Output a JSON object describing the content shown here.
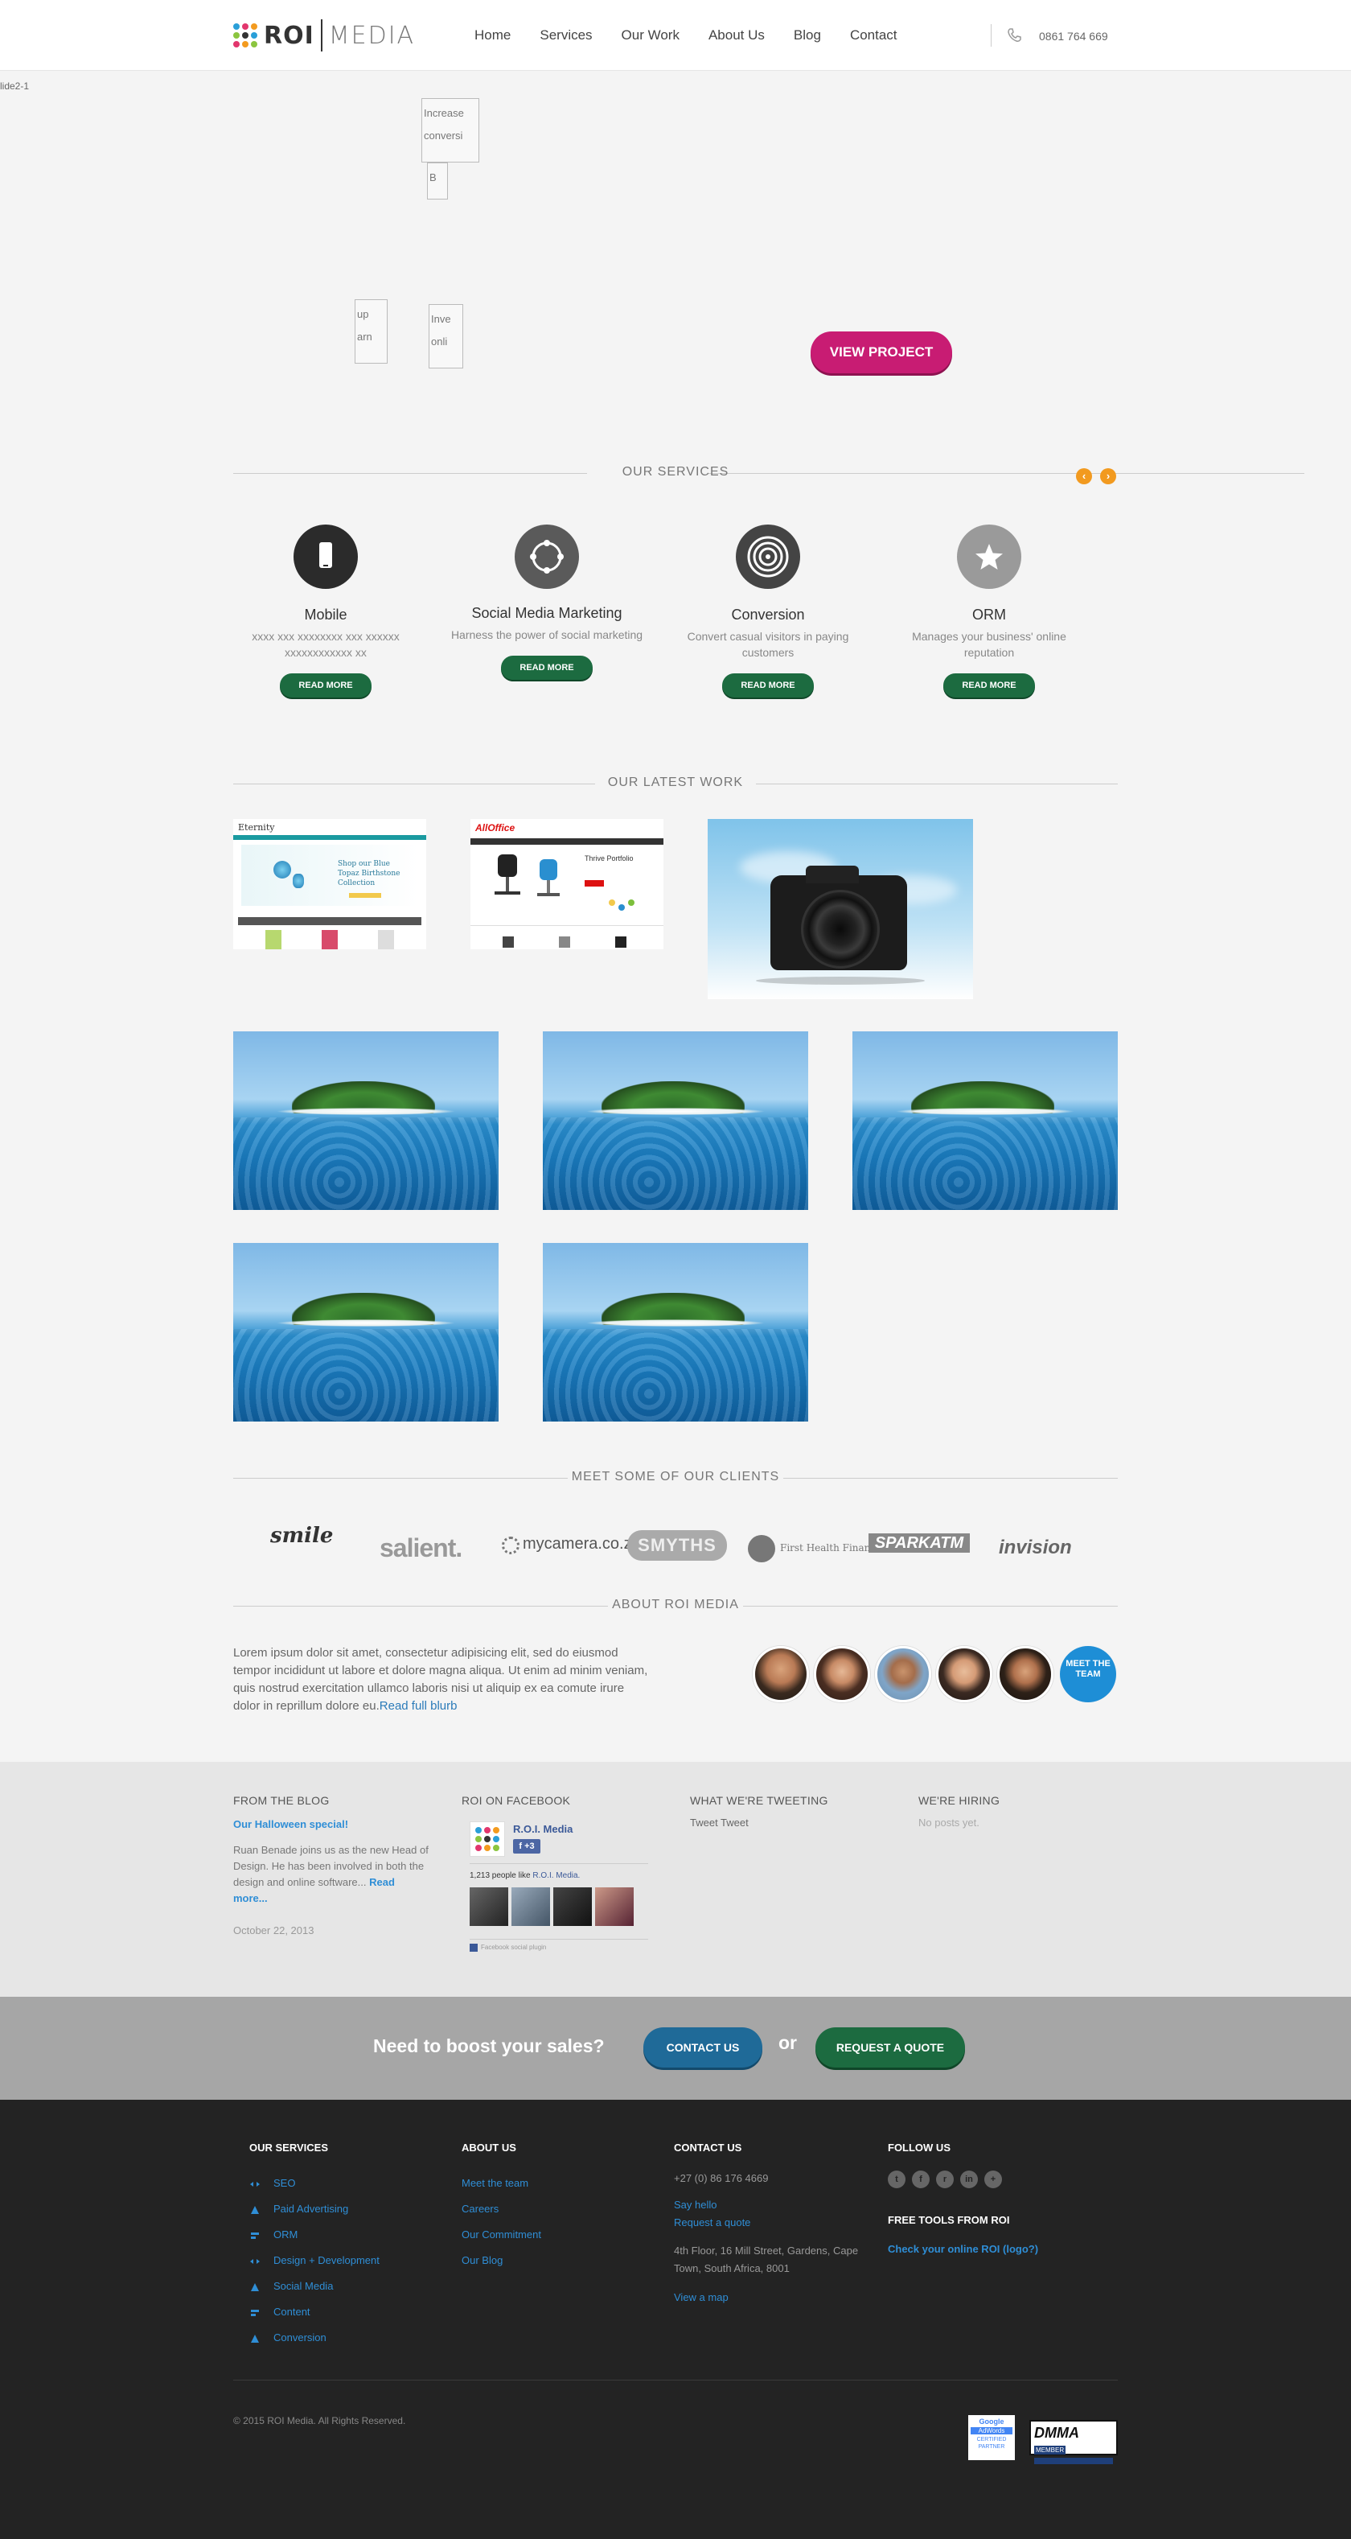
{
  "header": {
    "logo": {
      "roi": "ROI",
      "media": "MEDIA"
    },
    "nav": [
      "Home",
      "Services",
      "Our Work",
      "About Us",
      "Blog",
      "Contact"
    ],
    "phone": "0861 764 669"
  },
  "slider": {
    "label": "lide2-1",
    "broken_images": [
      "Increase conversi",
      "B",
      "up arn",
      "Inve onli"
    ],
    "view_project": "VIEW PROJECT"
  },
  "services": {
    "title": "OUR SERVICES",
    "arrows": {
      "prev": "‹",
      "next": "›"
    },
    "items": [
      {
        "title": "Mobile",
        "desc": "xxxx xxx xxxxxxxx xxx xxxxxx xxxxxxxxxxxx xx",
        "button": "READ MORE",
        "icon": "mobile-icon"
      },
      {
        "title": "Social Media Marketing",
        "desc": "Harness the power of social marketing",
        "button": "READ MORE",
        "icon": "network-icon"
      },
      {
        "title": "Conversion",
        "desc": "Convert casual visitors in paying customers",
        "button": "READ MORE",
        "icon": "target-icon"
      },
      {
        "title": "ORM",
        "desc": "Manages your business' online reputation",
        "button": "READ MORE",
        "icon": "star-icon"
      }
    ]
  },
  "work": {
    "title": "OUR LATEST WORK",
    "eternity": {
      "brand": "Eternity",
      "banner": "Shop our Blue Topaz Birthstone Collection"
    },
    "alloffice": {
      "brand": "AllOffice",
      "headline": "Thrive Portfolio"
    }
  },
  "clients": {
    "title": "MEET SOME OF OUR CLIENTS",
    "logos": [
      "smile",
      "salient.",
      "mycamera.co.za",
      "SMYTHS",
      "First Health Finance",
      "SPARKATM",
      "invision"
    ]
  },
  "about": {
    "title": "ABOUT ROI MEDIA",
    "text": "Lorem ipsum dolor sit amet, consectetur adipisicing elit, sed do eiusmod tempor incididunt ut labore et dolore magna aliqua. Ut enim ad minim veniam, quis nostrud exercitation ullamco laboris nisi ut aliquip ex ea comute irure dolor in reprillum dolore eu.",
    "link": "Read full blurb",
    "meet_team": "MEET THE TEAM"
  },
  "widgets": {
    "blog": {
      "title": "FROM THE BLOG",
      "post_title": "Our Halloween special!",
      "post_text": "Ruan Benade joins us as the new Head of Design. He has been involved in both the design and online software...",
      "read_more": "Read more...",
      "date": "October 22, 2013"
    },
    "facebook": {
      "title": "ROI ON FACEBOOK",
      "page_name": "R.O.I. Media",
      "likes_prefix": "1,213 people like",
      "likes_page": "R.O.I. Media.",
      "plugin": "Facebook social plugin",
      "like_count": "+3"
    },
    "twitter": {
      "title": "WHAT WE'RE TWEETING",
      "text": "Tweet Tweet"
    },
    "hiring": {
      "title": "WE'RE HIRING",
      "text": "No posts yet."
    }
  },
  "cta": {
    "text": "Need to boost your sales?",
    "contact": "CONTACT US",
    "or": "or",
    "quote": "REQUEST A QUOTE"
  },
  "footer": {
    "services": {
      "title": "OUR SERVICES",
      "items": [
        "SEO",
        "Paid Advertising",
        "ORM",
        "Design + Development",
        "Social Media",
        "Content",
        "Conversion"
      ]
    },
    "about": {
      "title": "ABOUT US",
      "items": [
        "Meet the team",
        "Careers",
        "Our Commitment",
        "Our Blog"
      ]
    },
    "contact": {
      "title": "CONTACT US",
      "phone": "+27 (0) 86 176 4669",
      "say_hello": "Say hello",
      "request_quote": "Request a quote",
      "address": "4th Floor, 16 Mill Street, Gardens, Cape Town, South Africa, 8001",
      "map": "View a map"
    },
    "follow": {
      "title": "FOLLOW US",
      "icons": [
        "twitter-icon",
        "facebook-icon",
        "rss-icon",
        "linkedin-icon",
        "googleplus-icon"
      ],
      "glyphs": [
        "t",
        "f",
        "r",
        "in",
        "+"
      ]
    },
    "tools": {
      "title": "FREE TOOLS FROM ROI",
      "link": "Check your online ROI (logo?)"
    },
    "copyright": "© 2015 ROI Media. All Rights Reserved.",
    "badges": {
      "google": {
        "top": "Google",
        "mid": "AdWords",
        "bottom": "CERTIFIED PARTNER"
      },
      "dmma": {
        "name": "DMMA",
        "label": "MEMBER"
      }
    }
  }
}
